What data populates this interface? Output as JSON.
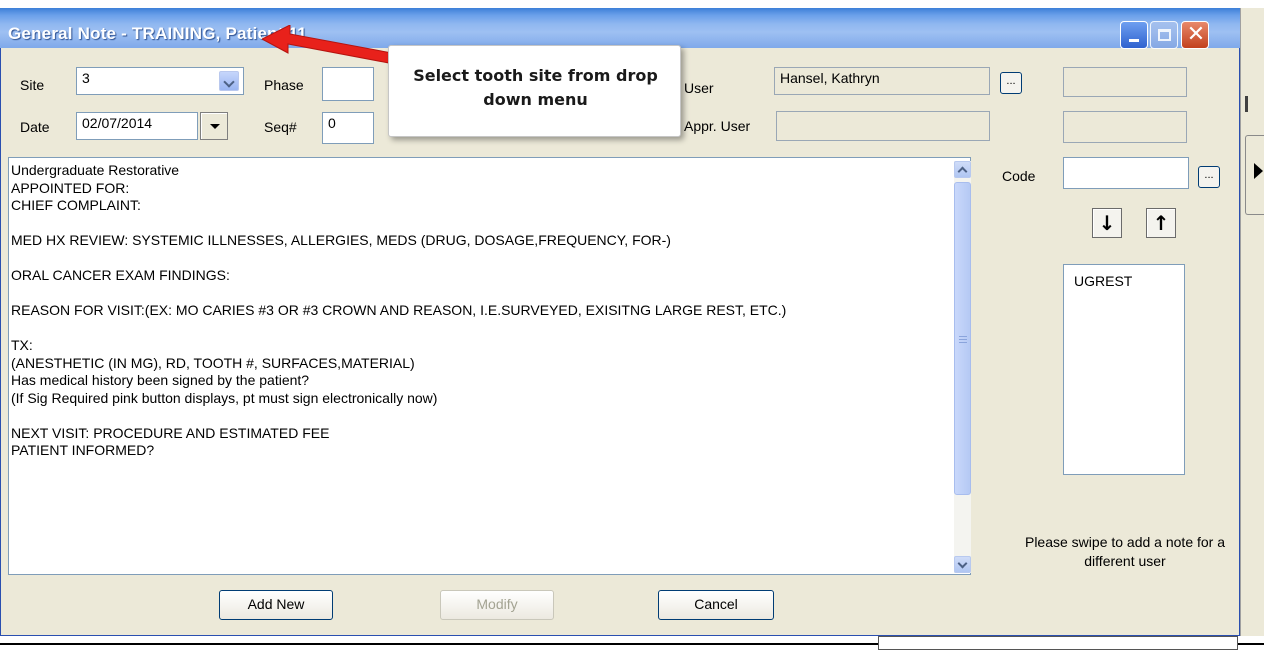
{
  "window": {
    "title": "General Note - TRAINING, Patient 11",
    "controls": [
      "minimize-icon",
      "maximize-icon",
      "close-icon"
    ]
  },
  "form": {
    "site_label": "Site",
    "site_value": "3",
    "phase_label": "Phase",
    "phase_value": "",
    "date_label": "Date",
    "date_value": "02/07/2014",
    "seq_label": "Seq#",
    "seq_value": "0",
    "user_label": "User",
    "user_value": "Hansel, Kathryn",
    "appr_user_label": "Appr. User",
    "appr_user_value": "",
    "ellipsis": "...",
    "code_label": "Code",
    "code_value": ""
  },
  "note": {
    "lines": "Undergraduate Restorative\nAPPOINTED FOR:\nCHIEF COMPLAINT:\n\nMED HX REVIEW: SYSTEMIC ILLNESSES, ALLERGIES, MEDS (DRUG, DOSAGE,FREQUENCY, FOR-)\n\nORAL CANCER EXAM FINDINGS:\n\nREASON FOR VISIT:(EX: MO CARIES #3 OR #3 CROWN AND REASON, I.E.SURVEYED, EXISITNG LARGE REST, ETC.)\n\nTX:\n(ANESTHETIC (IN MG), RD, TOOTH #, SURFACES,MATERIAL)\nHas medical history been signed by the patient?\n(If Sig Required pink button displays, pt must sign electronically now)\n\nNEXT VISIT: PROCEDURE AND ESTIMATED FEE\nPATIENT INFORMED?"
  },
  "codes": {
    "down_arrow": "↓",
    "up_arrow": "↑",
    "items": [
      "UGREST"
    ]
  },
  "swipe_message": "Please swipe to add a note for a different user",
  "buttons": {
    "add_new": "Add New",
    "modify": "Modify",
    "cancel": "Cancel"
  },
  "annotation": {
    "text": "Select tooth site from drop down menu",
    "arrow_color": "#e8211b"
  }
}
